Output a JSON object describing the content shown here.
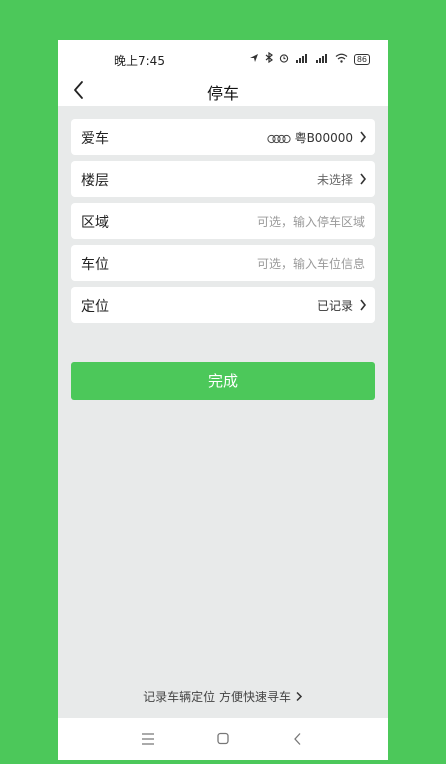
{
  "status": {
    "time": "晚上7:45",
    "battery": "86"
  },
  "nav": {
    "title": "停车"
  },
  "form": {
    "car_label": "爱车",
    "car_plate": "粤B00000",
    "floor_label": "楼层",
    "floor_value": "未选择",
    "area_label": "区域",
    "area_placeholder": "可选，输入停车区域",
    "spot_label": "车位",
    "spot_placeholder": "可选，输入车位信息",
    "location_label": "定位",
    "location_value": "已记录"
  },
  "done_label": "完成",
  "footer": {
    "link": "记录车辆定位 方便快速寻车"
  },
  "colors": {
    "brand_green": "#4cc85a",
    "background": "#e8eaea"
  }
}
